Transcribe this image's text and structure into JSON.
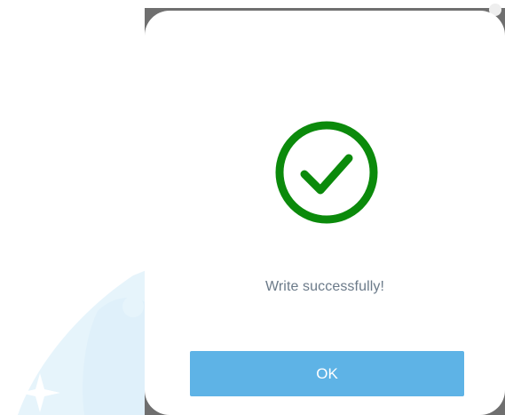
{
  "dialog": {
    "icon": "check-circle-icon",
    "message": "Write successfully!",
    "ok_label": "OK"
  },
  "colors": {
    "success_green": "#0b8a0b",
    "button_blue": "#5eb3e6",
    "message_text": "#6b7a89",
    "scrim": "#6f6f6f",
    "watermark": "#e3f3fb"
  }
}
